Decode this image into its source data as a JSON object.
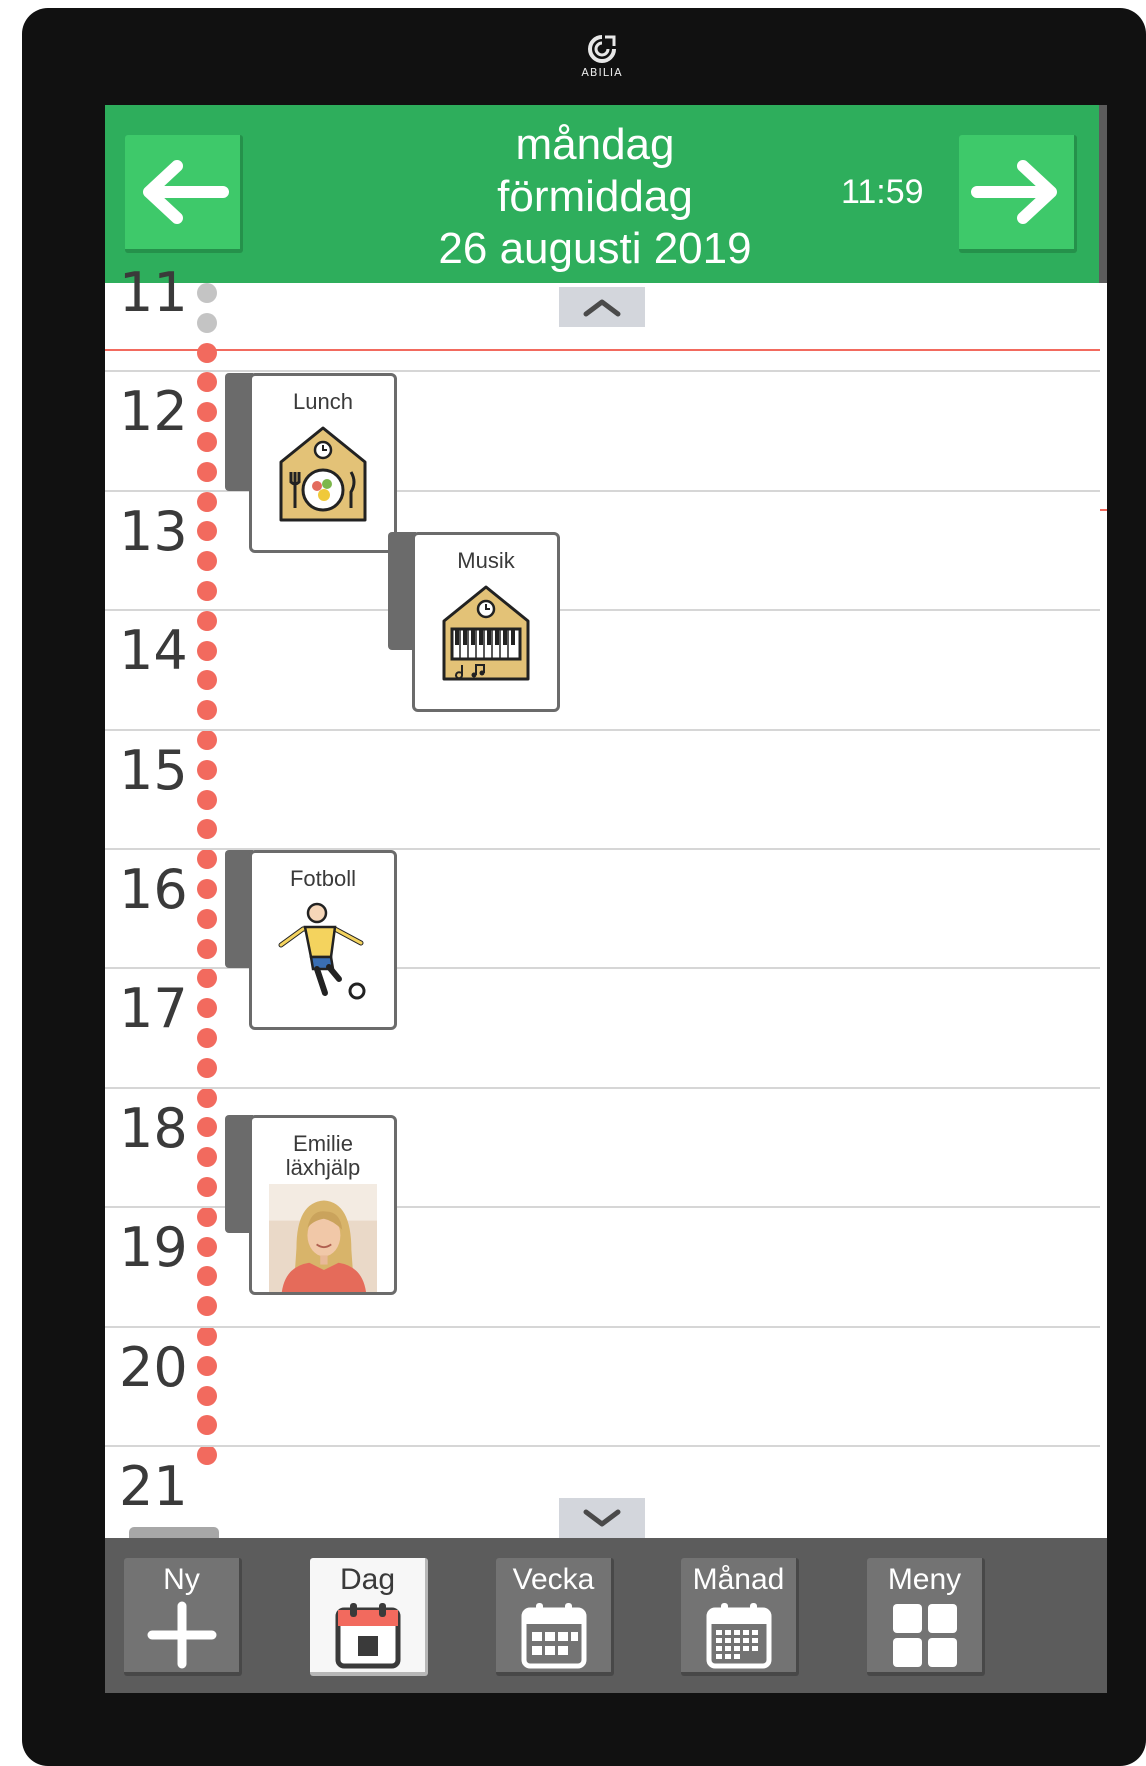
{
  "device": {
    "brand": "ABILIA"
  },
  "header": {
    "day": "måndag",
    "period": "förmiddag",
    "date": "26 augusti 2019",
    "time": "11:59",
    "prev_icon": "arrow-left-icon",
    "next_icon": "arrow-right-icon"
  },
  "timeline": {
    "hours": [
      "11",
      "12",
      "13",
      "14",
      "15",
      "16",
      "17",
      "18",
      "19",
      "20",
      "21"
    ],
    "scroll_up_icon": "chevron-up-icon",
    "scroll_down_icon": "chevron-down-icon"
  },
  "activities": [
    {
      "title": "Lunch",
      "icon": "lunch-icon"
    },
    {
      "title": "Musik",
      "icon": "piano-icon"
    },
    {
      "title": "Fotboll",
      "icon": "football-player-icon"
    },
    {
      "title": "Emilie\nläxhjälp",
      "icon": "person-photo"
    }
  ],
  "toolbar": {
    "items": [
      {
        "label": "Ny",
        "icon": "plus-icon",
        "active": false
      },
      {
        "label": "Dag",
        "icon": "calendar-day-icon",
        "active": true
      },
      {
        "label": "Vecka",
        "icon": "calendar-week-icon",
        "active": false
      },
      {
        "label": "Månad",
        "icon": "calendar-month-icon",
        "active": false
      },
      {
        "label": "Meny",
        "icon": "grid-menu-icon",
        "active": false
      }
    ]
  },
  "colors": {
    "header_green": "#2eae5c",
    "button_green": "#3ec96a",
    "now_red": "#f26a5e",
    "toolbar_gray": "#5c5c5c",
    "picto_gold": "#e3c277"
  }
}
